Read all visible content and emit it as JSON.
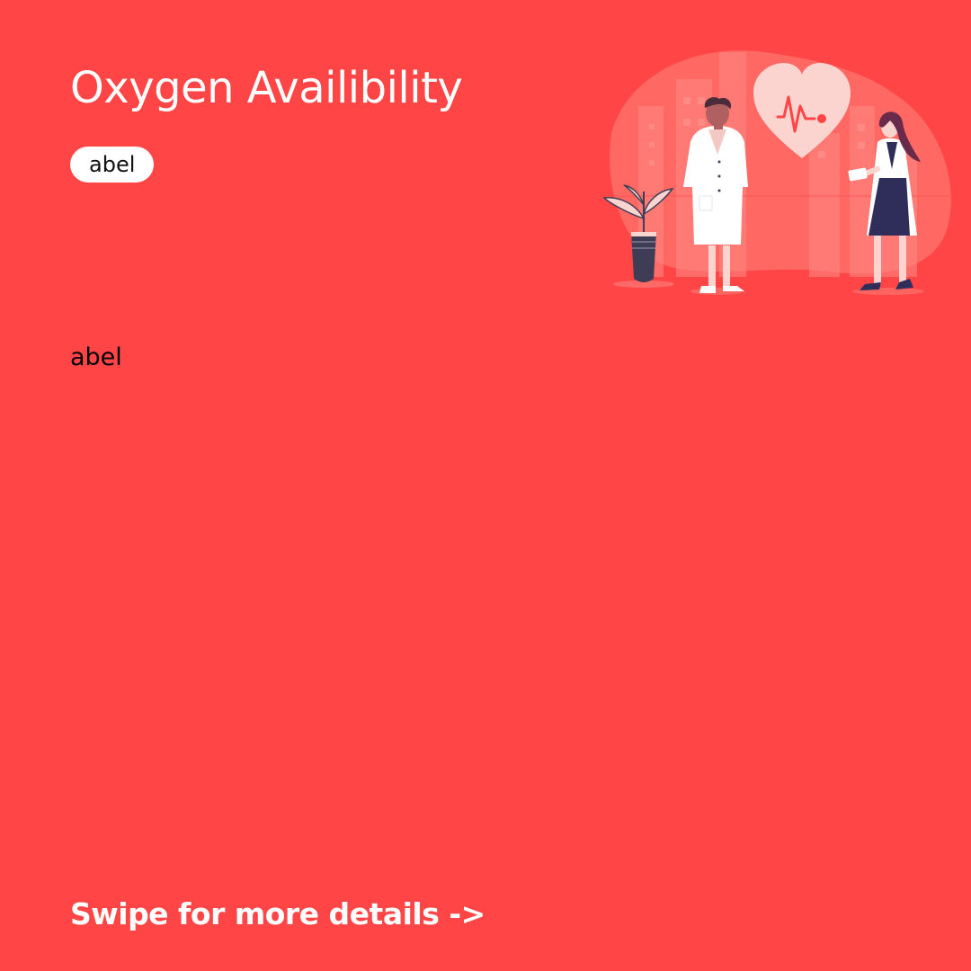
{
  "card": {
    "title": "Oxygen Availibility",
    "tag_label": "abel",
    "body_label": "abel",
    "footer_cta": "Swipe for more details ->"
  },
  "illustration": {
    "icon": "doctors-heartbeat-illustration"
  },
  "colors": {
    "background": "#ff4545",
    "title_text": "#ffffff",
    "tag_background": "#ffffff",
    "body_text": "#000000"
  }
}
